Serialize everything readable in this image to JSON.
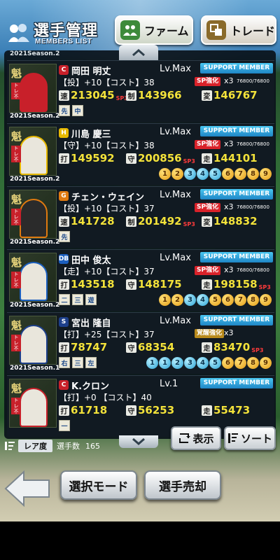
{
  "header": {
    "title": "選手管理",
    "subtitle": "MEMBERS LIST",
    "farm_label": "ファーム",
    "trade_label": "トレード"
  },
  "list": {
    "top_season": "2021Season.2",
    "players": [
      {
        "team": "C",
        "team_color": "#c8202a",
        "name": "岡田 明丈",
        "level": "Lv.Max",
        "support": "SUPPORT MEMBER",
        "position": "【投】+10【コスト】38",
        "sp": "SP強化",
        "mult": "x3",
        "exp": "76800/76800",
        "stats": [
          {
            "k": "速",
            "v": "213045",
            "sp3": "SP3"
          },
          {
            "k": "制",
            "v": "143966",
            "sp3": ""
          },
          {
            "k": "変",
            "v": "146767",
            "sp3": ""
          }
        ],
        "positions": [
          "先",
          "中"
        ],
        "balls": [],
        "season": "2021Season.2"
      },
      {
        "team": "H",
        "team_color": "#e6b800",
        "name": "川島 慶三",
        "level": "Lv.Max",
        "support": "SUPPORT MEMBER",
        "position": "【守】+10【コスト】38",
        "sp": "SP強化",
        "mult": "x3",
        "exp": "76800/76800",
        "stats": [
          {
            "k": "打",
            "v": "149592",
            "sp3": ""
          },
          {
            "k": "守",
            "v": "200856",
            "sp3": "SP3"
          },
          {
            "k": "走",
            "v": "144101",
            "sp3": ""
          }
        ],
        "positions": [],
        "balls": [
          "1",
          "2",
          "3",
          "4",
          "5",
          "6",
          "7",
          "8",
          "9"
        ],
        "season": "2021Season.2"
      },
      {
        "team": "G",
        "team_color": "#e07a10",
        "name": "チェン・ウェイン",
        "level": "Lv.Max",
        "support": "SUPPORT MEMBER",
        "position": "【投】+10【コスト】37",
        "sp": "SP強化",
        "mult": "x3",
        "exp": "76800/76800",
        "stats": [
          {
            "k": "速",
            "v": "141728",
            "sp3": ""
          },
          {
            "k": "制",
            "v": "201492",
            "sp3": "SP3"
          },
          {
            "k": "変",
            "v": "148832",
            "sp3": ""
          }
        ],
        "positions": [
          "先"
        ],
        "balls": [],
        "season": "2021Season.2"
      },
      {
        "team": "DB",
        "team_color": "#1b5fbf",
        "name": "田中 俊太",
        "level": "Lv.Max",
        "support": "SUPPORT MEMBER",
        "position": "【走】+10【コスト】37",
        "sp": "SP強化",
        "mult": "x3",
        "exp": "76800/76800",
        "stats": [
          {
            "k": "打",
            "v": "143518",
            "sp3": ""
          },
          {
            "k": "守",
            "v": "148175",
            "sp3": ""
          },
          {
            "k": "走",
            "v": "198158",
            "sp3": "SP3"
          }
        ],
        "positions": [
          "二",
          "三",
          "遊"
        ],
        "balls": [
          "1",
          "2",
          "3",
          "4",
          "5",
          "6",
          "7",
          "8",
          "9"
        ],
        "season": "2021Season.2"
      },
      {
        "team": "S",
        "team_color": "#1d3f8a",
        "name": "宮出 隆自",
        "level": "Lv.Max",
        "support": "SUPPORT MEMBER",
        "position": "【打】+25【コスト】37",
        "sp": "覚醒強化",
        "mult": "x3",
        "exp": "",
        "stats": [
          {
            "k": "打",
            "v": "78747",
            "sp3": ""
          },
          {
            "k": "守",
            "v": "68354",
            "sp3": ""
          },
          {
            "k": "走",
            "v": "83470",
            "sp3": "SP3"
          }
        ],
        "positions": [
          "右",
          "三",
          "左"
        ],
        "balls": [
          "1",
          "1",
          "2",
          "3",
          "4",
          "5",
          "6",
          "7",
          "8",
          "9"
        ],
        "season": "2021Season.1"
      },
      {
        "team": "C",
        "team_color": "#c8202a",
        "name": "K.クロン",
        "level": "Lv.1",
        "support": "SUPPORT MEMBER",
        "position": "【打】+0 【コスト】40",
        "sp": "",
        "mult": "",
        "exp": "",
        "stats": [
          {
            "k": "打",
            "v": "61718",
            "sp3": ""
          },
          {
            "k": "守",
            "v": "56253",
            "sp3": ""
          },
          {
            "k": "走",
            "v": "55473",
            "sp3": ""
          }
        ],
        "positions": [
          "一"
        ],
        "balls": [],
        "season": ""
      }
    ]
  },
  "footer": {
    "rarity_label": "レア度",
    "count_label": "選手数",
    "count_value": "165",
    "display_label": "表示",
    "sort_label": "ソート"
  },
  "bottom": {
    "select_mode_label": "選択モード",
    "sell_label": "選手売却"
  }
}
